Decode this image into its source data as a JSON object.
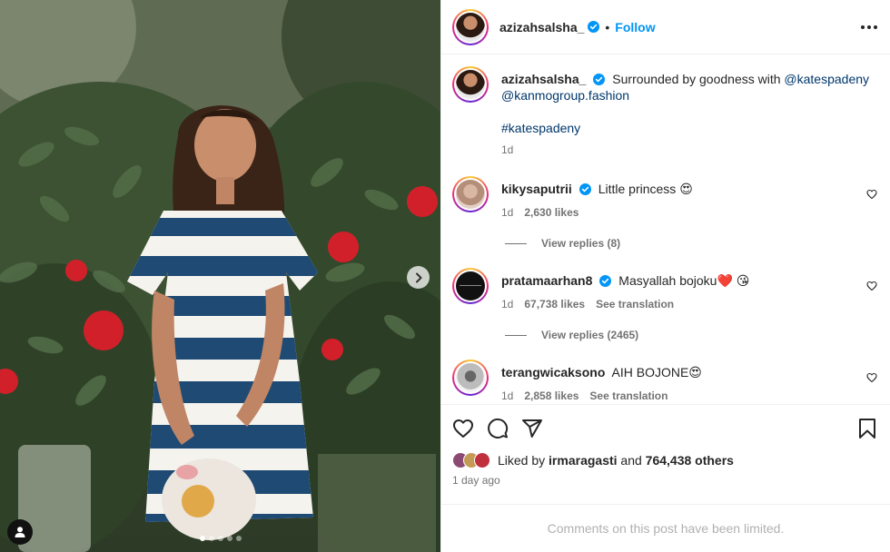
{
  "post": {
    "author": "azizahsalsha_",
    "follow_label": "Follow",
    "bullet": "•",
    "caption": {
      "text": "Surrounded by goodness with",
      "mention_1": "@katespadeny",
      "mention_2": "@kanmogroup.fashion",
      "hashtag": "#katespadeny",
      "time": "1d"
    }
  },
  "comments": [
    {
      "user": "kikysaputrii",
      "text": "Little princess 😍",
      "time": "1d",
      "likes": "2,630 likes",
      "replies": "View replies (8)"
    },
    {
      "user": "pratamaarhan8",
      "text": "Masyallah bojoku❤️ 😘",
      "time": "1d",
      "likes": "67,738 likes",
      "translate": "See translation",
      "replies": "View replies (2465)"
    },
    {
      "user": "terangwicaksono",
      "text": "AIH BOJONE😍",
      "time": "1d",
      "likes": "2,858 likes",
      "translate": "See translation"
    }
  ],
  "likes": {
    "prefix": "Liked by",
    "user": "irmaragasti",
    "middle": "and",
    "others": "764,438 others"
  },
  "posted_ago": "1 day ago",
  "comments_limited": "Comments on this post have been limited.",
  "carousel": {
    "current": 1,
    "total": 5
  },
  "colors": {
    "accent": "#0095f6",
    "verified": "#0095f6",
    "link": "#00376b",
    "muted": "#737373"
  },
  "icons": [
    "verified-badge-icon",
    "more-options-icon",
    "heart-icon",
    "comment-icon",
    "share-icon",
    "save-icon",
    "next-arrow-icon",
    "tagged-user-icon"
  ]
}
